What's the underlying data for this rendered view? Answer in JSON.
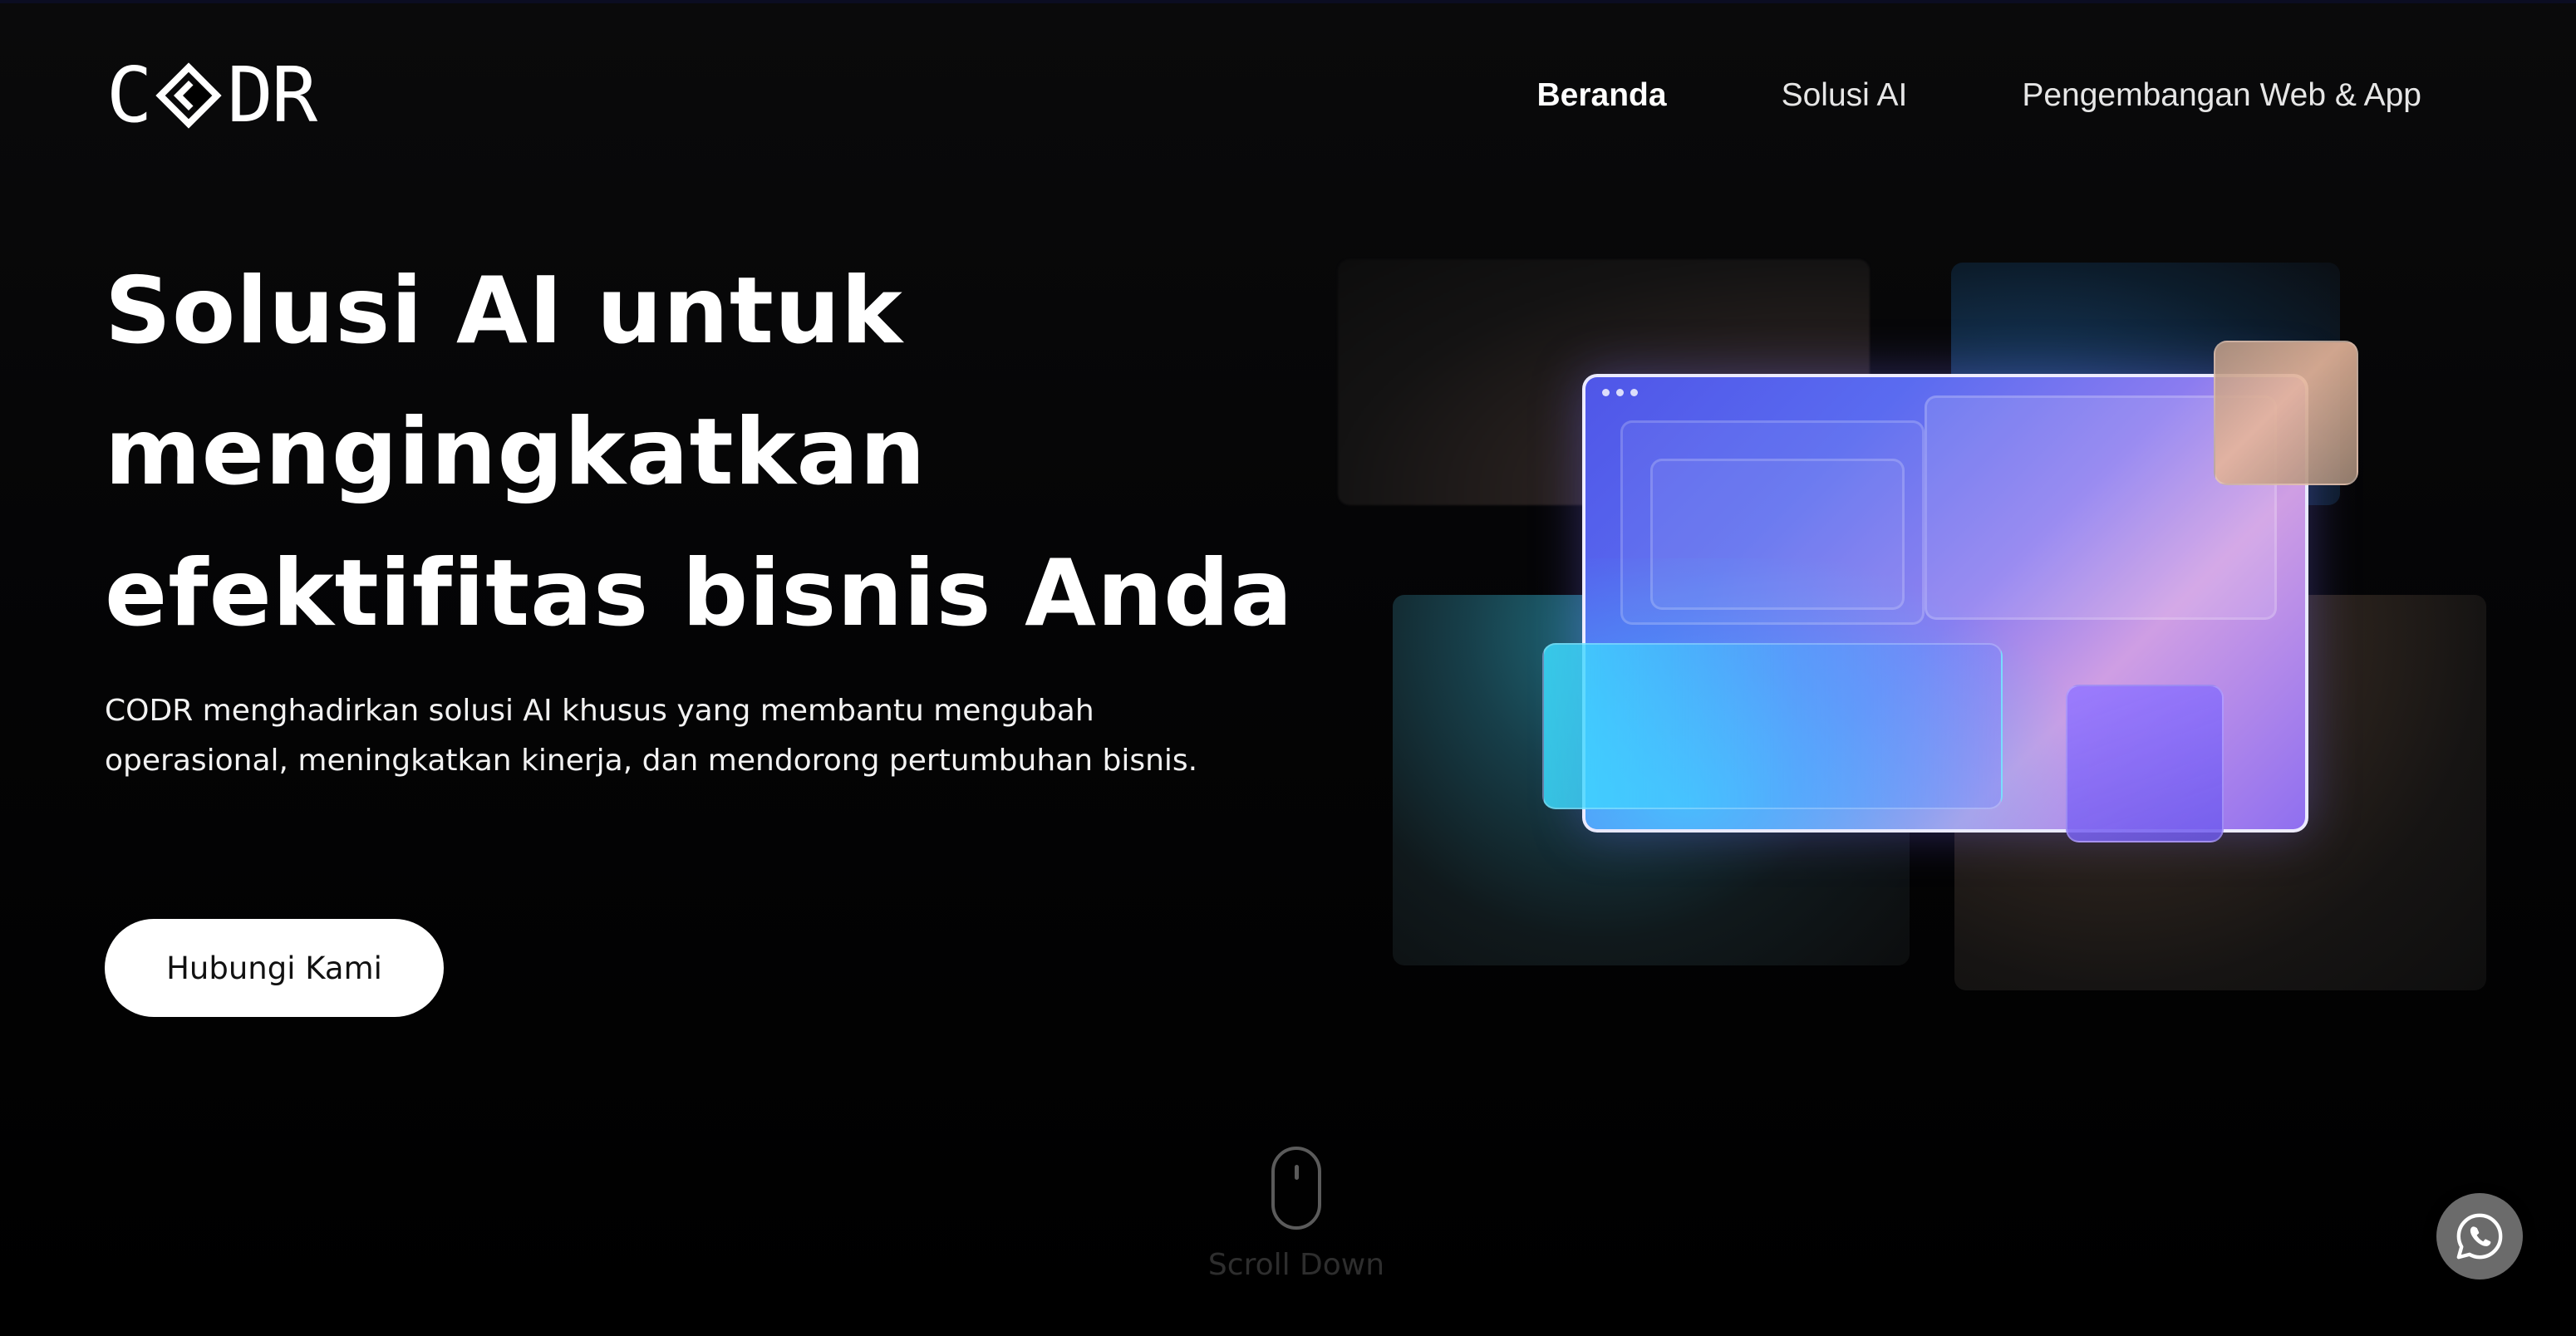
{
  "brand": {
    "logo_left": "C",
    "logo_right": "DR",
    "logo_icon": "codr-diamond-logo-mark"
  },
  "nav": {
    "items": [
      {
        "label": "Beranda",
        "active": true
      },
      {
        "label": "Solusi AI",
        "active": false
      },
      {
        "label": "Pengembangan Web & App",
        "active": false
      }
    ]
  },
  "hero": {
    "title_lines": [
      "Solusi AI untuk",
      "mengingkatkan",
      "efektifitas bisnis Anda"
    ],
    "subtitle_lines": [
      "CODR menghadirkan solusi AI khusus yang membantu mengubah",
      "operasional, meningkatkan kinerja, dan mendorong pertumbuhan bisnis."
    ],
    "cta_label": "Hubungi Kami"
  },
  "scroll": {
    "icon": "mouse-icon",
    "label": "Scroll Down"
  },
  "whatsapp": {
    "icon": "whatsapp-icon"
  },
  "colors": {
    "background": "#000000",
    "text": "#ffffff",
    "cta_bg": "#ffffff",
    "accent_blue": "#4f56e8",
    "accent_cyan": "#40c8ff",
    "accent_violet": "#8b7cf0"
  }
}
